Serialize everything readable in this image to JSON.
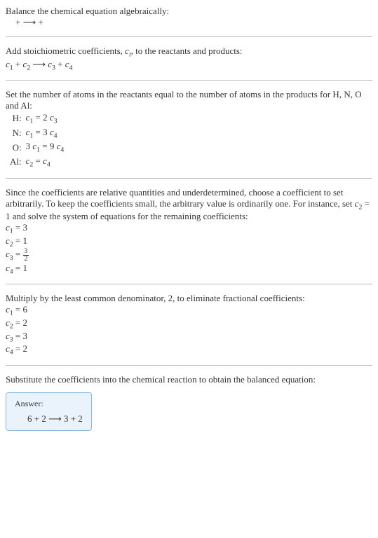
{
  "section1": {
    "line1": "Balance the chemical equation algebraically:",
    "eq": " +  ⟶  + "
  },
  "section2": {
    "line1": "Add stoichiometric coefficients, ",
    "ci": "c",
    "ci_sub": "i",
    "line1b": ", to the reactants and products:",
    "eq_c1": "c",
    "eq_c1s": "1",
    "eq_c2": "c",
    "eq_c2s": "2",
    "eq_c3": "c",
    "eq_c3s": "3",
    "eq_c4": "c",
    "eq_c4s": "4",
    "plus": " + ",
    "arrow": " ⟶ "
  },
  "section3": {
    "line1": "Set the number of atoms in the reactants equal to the number of atoms in the products for H, N, O and Al:",
    "rows": [
      {
        "el": "H:",
        "lhs_a": "c",
        "lhs_as": "1",
        "eq": " = 2 ",
        "rhs_a": "c",
        "rhs_as": "3",
        "pre": ""
      },
      {
        "el": "N:",
        "lhs_a": "c",
        "lhs_as": "1",
        "eq": " = 3 ",
        "rhs_a": "c",
        "rhs_as": "4",
        "pre": ""
      },
      {
        "el": "O:",
        "lhs_a": "c",
        "lhs_as": "1",
        "eq": " = 9 ",
        "rhs_a": "c",
        "rhs_as": "4",
        "pre": "3 "
      },
      {
        "el": "Al:",
        "lhs_a": "c",
        "lhs_as": "2",
        "eq": " = ",
        "rhs_a": "c",
        "rhs_as": "4",
        "pre": ""
      }
    ]
  },
  "section4": {
    "line1a": "Since the coefficients are relative quantities and underdetermined, choose a coefficient to set arbitrarily. To keep the coefficients small, the arbitrary value is ordinarily one. For instance, set ",
    "c2": "c",
    "c2s": "2",
    "line1b": " = 1 and solve the system of equations for the remaining coefficients:",
    "r1a": "c",
    "r1s": "1",
    "r1v": " = 3",
    "r2a": "c",
    "r2s": "2",
    "r2v": " = 1",
    "r3a": "c",
    "r3s": "3",
    "r3v_eq": " = ",
    "frac_num": "3",
    "frac_den": "2",
    "r4a": "c",
    "r4s": "4",
    "r4v": " = 1"
  },
  "section5": {
    "line1": "Multiply by the least common denominator, 2, to eliminate fractional coefficients:",
    "r1a": "c",
    "r1s": "1",
    "r1v": " = 6",
    "r2a": "c",
    "r2s": "2",
    "r2v": " = 2",
    "r3a": "c",
    "r3s": "3",
    "r3v": " = 3",
    "r4a": "c",
    "r4s": "4",
    "r4v": " = 2"
  },
  "section6": {
    "line1": "Substitute the coefficients into the chemical reaction to obtain the balanced equation:"
  },
  "answer": {
    "label": "Answer:",
    "eq": "6  + 2  ⟶ 3  + 2 "
  }
}
